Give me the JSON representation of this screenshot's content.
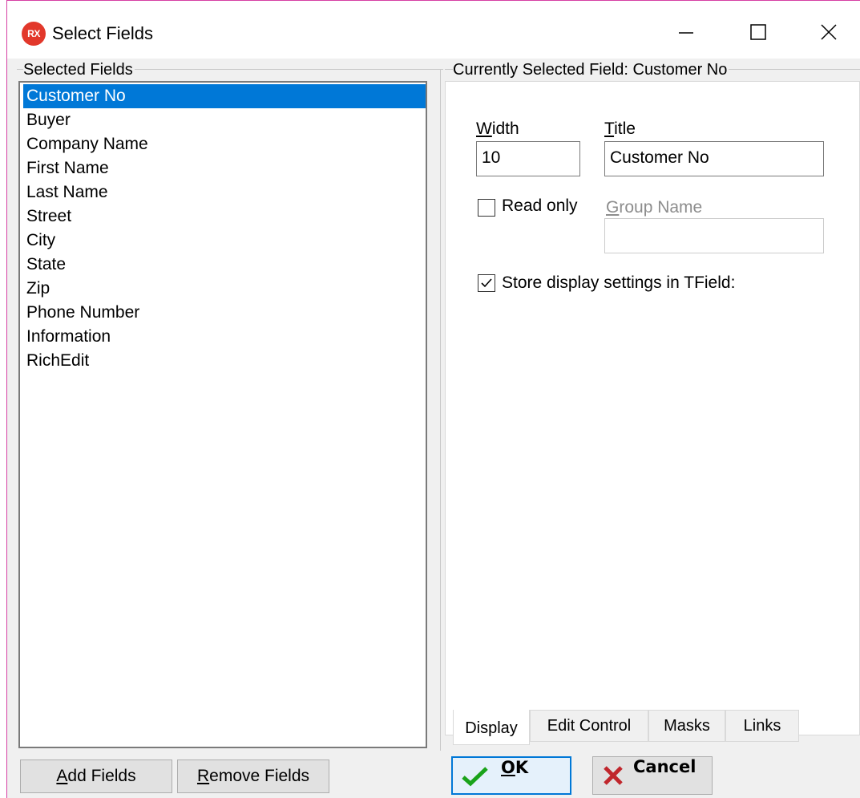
{
  "window": {
    "title": "Select Fields",
    "icon_text": "RX",
    "controls": [
      "minimize-icon",
      "maximize-icon",
      "close-icon"
    ]
  },
  "left_panel": {
    "label": "Selected Fields",
    "items": [
      {
        "label": "Customer No",
        "selected": true
      },
      {
        "label": "Buyer"
      },
      {
        "label": "Company Name"
      },
      {
        "label": "First Name"
      },
      {
        "label": "Last Name"
      },
      {
        "label": "Street"
      },
      {
        "label": "City"
      },
      {
        "label": "State"
      },
      {
        "label": "Zip"
      },
      {
        "label": "Phone Number"
      },
      {
        "label": "Information"
      },
      {
        "label": "RichEdit"
      }
    ],
    "buttons": {
      "add": {
        "accel": "A",
        "rest": "dd Fields"
      },
      "remove": {
        "accel": "R",
        "rest": "emove Fields"
      }
    }
  },
  "right_panel": {
    "label": "Currently Selected Field: Customer No",
    "width": {
      "accel": "W",
      "rest": "idth",
      "value": "10"
    },
    "title": {
      "accel": "T",
      "rest": "itle",
      "value": "Customer No"
    },
    "read_only": {
      "label": "Read only",
      "checked": false
    },
    "group_name": {
      "accel": "G",
      "rest": "roup Name",
      "value": ""
    },
    "store_display": {
      "label": "Store display settings in TField:",
      "checked": true
    },
    "tabs": [
      "Display",
      "Edit Control",
      "Masks",
      "Links"
    ],
    "active_tab": "Display"
  },
  "footer": {
    "ok": {
      "accel": "O",
      "rest": "K"
    },
    "cancel": {
      "label": "Cancel"
    }
  },
  "colors": {
    "selection": "#0078d7",
    "ok_check": "#1aa31a",
    "cancel_x": "#c0262c",
    "app_icon": "#e2382b"
  }
}
